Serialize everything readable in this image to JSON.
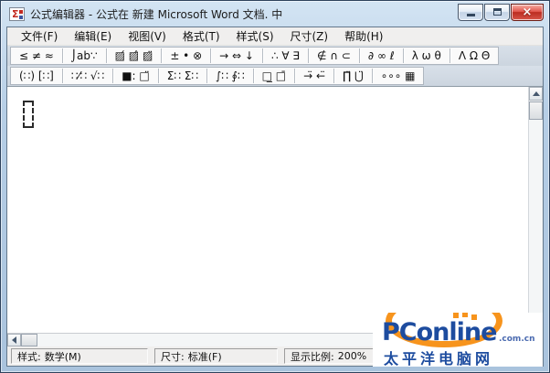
{
  "window": {
    "title": "公式编辑器 - 公式在 新建 Microsoft Word 文档. 中",
    "app_icon_glyph": "Σ",
    "close_glyph": "×"
  },
  "menu": {
    "items": [
      {
        "label": "文件(F)"
      },
      {
        "label": "编辑(E)"
      },
      {
        "label": "视图(V)"
      },
      {
        "label": "格式(T)"
      },
      {
        "label": "样式(S)"
      },
      {
        "label": "尺寸(Z)"
      },
      {
        "label": "帮助(H)"
      }
    ]
  },
  "toolbar": {
    "symbols": [
      {
        "name": "relational-symbols",
        "glyphs": "≤ ≠ ≈"
      },
      {
        "name": "spaces-ellipses",
        "glyphs": "⌡ab∵"
      },
      {
        "name": "embellishments",
        "glyphs": "▨́ ▨̂ ▨̈"
      },
      {
        "name": "operator-symbols",
        "glyphs": "± • ⊗"
      },
      {
        "name": "arrow-symbols",
        "glyphs": "→ ⇔ ↓"
      },
      {
        "name": "logical-symbols",
        "glyphs": "∴ ∀ ∃"
      },
      {
        "name": "set-theory-symbols",
        "glyphs": "∉ ∩ ⊂"
      },
      {
        "name": "misc-symbols",
        "glyphs": "∂ ∞ ℓ"
      },
      {
        "name": "greek-lowercase",
        "glyphs": "λ ω θ"
      },
      {
        "name": "greek-uppercase",
        "glyphs": "Λ Ω Θ"
      }
    ],
    "templates": [
      {
        "name": "fence-templates",
        "glyphs": "(∷) [∷]"
      },
      {
        "name": "fraction-radical-templates",
        "glyphs": "∷⁄∷ √∷"
      },
      {
        "name": "subscript-superscript-templates",
        "glyphs": "■: □̈"
      },
      {
        "name": "summation-templates",
        "glyphs": "Σ∷ Σ∷"
      },
      {
        "name": "integral-templates",
        "glyphs": "∫∷ ∮∷"
      },
      {
        "name": "bar-templates",
        "glyphs": "□̲ □̄"
      },
      {
        "name": "labeled-arrow-templates",
        "glyphs": "→̈ ←̈"
      },
      {
        "name": "product-set-templates",
        "glyphs": "∏̈ ⋃̈"
      },
      {
        "name": "matrix-templates",
        "glyphs": "∘∘∘ ▦"
      }
    ]
  },
  "statusbar": {
    "style": {
      "label": "样式:",
      "value": "数学(M)"
    },
    "size": {
      "label": "尺寸:",
      "value": "标准(F)"
    },
    "zoom": {
      "label": "显示比例:",
      "value": "200%"
    }
  },
  "watermark": {
    "brand": "PConline",
    "domain": ".com.cn",
    "subtitle": "太平洋电脑网",
    "orange": "#f7941d",
    "blue": "#1d4c9f"
  }
}
